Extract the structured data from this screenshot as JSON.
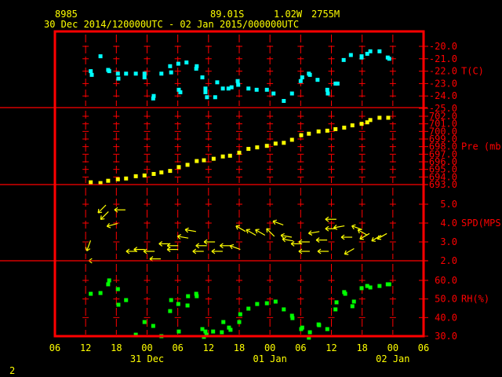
{
  "header": {
    "station": "8985",
    "lat": "89.01S",
    "lon": "1.02W",
    "elev": "2755M",
    "period": "30 Dec 2014/120000UTC - 02 Jan 2015/000000UTC"
  },
  "footer": {
    "page_number": "2"
  },
  "colors": {
    "frame": "#ff0000",
    "text": "#ffff00",
    "temp": "#00ffff",
    "pressure": "#ffff00",
    "wind": "#ffff00",
    "rh": "#00ff00"
  },
  "chart_data": {
    "type": "scatter",
    "x_units": "hours since 30 Dec 2014 00UTC",
    "xlim": [
      6,
      78
    ],
    "x_ticks": [
      {
        "h": 6,
        "label": "06"
      },
      {
        "h": 12,
        "label": "12"
      },
      {
        "h": 18,
        "label": "18"
      },
      {
        "h": 24,
        "label": "00"
      },
      {
        "h": 30,
        "label": "06"
      },
      {
        "h": 36,
        "label": "12"
      },
      {
        "h": 42,
        "label": "18"
      },
      {
        "h": 48,
        "label": "00"
      },
      {
        "h": 54,
        "label": "06"
      },
      {
        "h": 60,
        "label": "12"
      },
      {
        "h": 66,
        "label": "18"
      },
      {
        "h": 72,
        "label": "00"
      },
      {
        "h": 78,
        "label": "06"
      }
    ],
    "date_labels": [
      {
        "h": 24,
        "label": "31 Dec"
      },
      {
        "h": 48,
        "label": "01 Jan"
      },
      {
        "h": 72,
        "label": "02 Jan"
      }
    ],
    "grid": true,
    "panels": [
      {
        "name": "temperature",
        "label": "T(C)",
        "ylim": [
          -25,
          -20
        ],
        "y_ticks": [
          "-20.0",
          "-21.0",
          "-22.0",
          "-23.0",
          "-24.0",
          "-25.0"
        ],
        "tick_values": [
          -20,
          -21,
          -22,
          -23,
          -24,
          -25
        ],
        "label_at": -22,
        "x": [
          13.0,
          13.2,
          14.9,
          16.4,
          16.6,
          18.3,
          18.4,
          19.9,
          21.8,
          23.5,
          23.5,
          25.2,
          25.3,
          26.8,
          28.5,
          28.7,
          30.1,
          30.2,
          30.5,
          31.7,
          33.6,
          33.7,
          34.8,
          35.4,
          35.4,
          35.7,
          37.3,
          37.7,
          38.8,
          39.9,
          40.5,
          41.7,
          41.8,
          43.8,
          45.4,
          47.4,
          48.7,
          50.7,
          52.3,
          54.0,
          54.3,
          55.6,
          55.8,
          57.3,
          59.2,
          59.3,
          60.8,
          61.2,
          62.4,
          63.8,
          65.9,
          65.9,
          67.0,
          67.6,
          69.4,
          71.0,
          71.3
        ],
        "y": [
          -22.0,
          -22.3,
          -20.8,
          -21.9,
          -22.0,
          -22.2,
          -22.6,
          -22.2,
          -22.2,
          -22.2,
          -22.5,
          -24.2,
          -24.0,
          -22.2,
          -21.6,
          -22.1,
          -21.4,
          -23.5,
          -23.7,
          -21.3,
          -21.8,
          -21.6,
          -22.5,
          -23.4,
          -23.7,
          -24.1,
          -24.1,
          -22.9,
          -23.4,
          -23.4,
          -23.3,
          -22.8,
          -23.1,
          -23.4,
          -23.5,
          -23.5,
          -23.8,
          -24.4,
          -23.8,
          -22.8,
          -22.5,
          -22.2,
          -22.3,
          -22.7,
          -23.5,
          -23.8,
          -23.0,
          -23.0,
          -21.1,
          -20.7,
          -20.9,
          -20.8,
          -20.6,
          -20.4,
          -20.4,
          -20.9,
          -21.0
        ]
      },
      {
        "name": "pressure",
        "label": "Pre (mb)",
        "ylim": [
          693,
          702
        ],
        "y_ticks": [
          "702.0",
          "701.0",
          "700.0",
          "699.0",
          "698.0",
          "697.0",
          "696.0",
          "695.0",
          "694.0",
          "693.0"
        ],
        "tick_values": [
          702,
          701,
          700,
          699,
          698,
          697,
          696,
          695,
          694,
          693
        ],
        "label_at": 698,
        "x": [
          13.0,
          14.9,
          16.4,
          18.3,
          19.9,
          21.8,
          23.5,
          25.3,
          26.8,
          28.5,
          30.2,
          31.9,
          33.7,
          35.1,
          37.0,
          38.8,
          40.2,
          42.0,
          43.8,
          45.5,
          47.4,
          49.1,
          50.7,
          52.3,
          54.1,
          55.6,
          57.5,
          59.2,
          60.8,
          62.5,
          64.1,
          65.9,
          67.0,
          67.6,
          69.4,
          71.1
        ],
        "y": [
          693.3,
          693.2,
          693.5,
          693.7,
          693.8,
          694.1,
          694.2,
          694.4,
          694.6,
          694.8,
          695.3,
          695.6,
          696.1,
          696.2,
          696.4,
          696.7,
          696.8,
          697.2,
          697.7,
          697.9,
          698.1,
          698.4,
          698.5,
          698.9,
          699.5,
          699.7,
          700.0,
          700.1,
          700.3,
          700.5,
          700.8,
          701.0,
          701.2,
          701.5,
          701.8,
          701.8
        ]
      },
      {
        "name": "wind",
        "label": "SPD(MPS)",
        "ylim": [
          2,
          5
        ],
        "y_ticks": [
          "5.0",
          "4.0",
          "3.0",
          "2.0"
        ],
        "tick_values": [
          5,
          4,
          3,
          2
        ],
        "label_at": 4,
        "x": [
          15.2,
          15.7,
          18.7,
          17.2,
          12.6,
          13.7,
          21.0,
          22.5,
          24.4,
          25.6,
          27.4,
          29.0,
          29.0,
          31.0,
          32.5,
          34.6,
          34.0,
          36.2,
          37.7,
          39.3,
          41.2,
          42.3,
          44.3,
          46.1,
          48.1,
          49.6,
          51.2,
          51.5,
          53.2,
          54.7,
          54.7,
          56.6,
          58.1,
          58.4,
          59.9,
          59.9,
          61.5,
          63.0,
          63.5,
          65.0,
          66.1,
          66.5,
          68.8,
          69.9
        ],
        "y": [
          4.75,
          4.4,
          4.7,
          3.9,
          2.8,
          2.0,
          2.5,
          2.6,
          2.5,
          2.1,
          2.9,
          2.8,
          2.6,
          3.25,
          3.6,
          2.8,
          2.5,
          3.0,
          2.5,
          2.8,
          2.7,
          3.7,
          3.5,
          3.5,
          3.5,
          4.0,
          3.3,
          3.1,
          2.9,
          3.0,
          2.5,
          3.5,
          3.1,
          2.5,
          4.2,
          3.7,
          3.8,
          3.25,
          2.5,
          3.75,
          3.5,
          3.3,
          3.2,
          3.3
        ],
        "direction_from_deg": [
          45,
          45,
          90,
          75,
          20,
          90,
          90,
          90,
          90,
          90,
          90,
          90,
          90,
          100,
          100,
          90,
          90,
          90,
          90,
          90,
          110,
          120,
          120,
          120,
          135,
          110,
          100,
          100,
          90,
          90,
          90,
          80,
          90,
          90,
          90,
          90,
          80,
          90,
          60,
          110,
          120,
          60,
          60,
          60
        ]
      },
      {
        "name": "relative_humidity",
        "label": "RH(%)",
        "ylim": [
          30,
          60
        ],
        "y_ticks": [
          "60.0",
          "50.0",
          "40.0",
          "30.0"
        ],
        "tick_values": [
          60,
          50,
          40,
          30
        ],
        "label_at": 50,
        "x": [
          13.0,
          14.9,
          16.4,
          16.6,
          18.3,
          18.4,
          19.9,
          21.8,
          23.5,
          25.2,
          26.8,
          28.5,
          28.7,
          30.1,
          30.2,
          31.9,
          32.0,
          33.6,
          33.7,
          34.8,
          35.4,
          35.1,
          35.6,
          36.9,
          38.6,
          38.9,
          40.0,
          40.3,
          42.0,
          42.2,
          43.8,
          45.5,
          47.4,
          49.1,
          50.7,
          52.3,
          52.4,
          54.1,
          54.3,
          55.8,
          55.6,
          57.5,
          57.6,
          59.2,
          60.8,
          61.0,
          62.5,
          62.7,
          64.1,
          64.4,
          65.9,
          67.0,
          67.6,
          69.4,
          71.0,
          71.3
        ],
        "y": [
          52.8,
          53.2,
          57.9,
          60.0,
          55.3,
          46.9,
          49.4,
          30.8,
          37.6,
          35.5,
          30.0,
          43.5,
          49.4,
          47.3,
          32.5,
          46.5,
          51.5,
          52.8,
          51.5,
          33.8,
          32.5,
          29.6,
          30.8,
          32.5,
          32.1,
          37.6,
          34.6,
          33.4,
          37.6,
          41.8,
          44.8,
          47.3,
          47.7,
          48.6,
          44.4,
          41.0,
          39.7,
          33.8,
          34.6,
          32.1,
          29.2,
          36.3,
          35.9,
          33.8,
          44.4,
          48.2,
          53.7,
          52.8,
          46.1,
          48.6,
          55.8,
          57.0,
          56.2,
          57.0,
          57.9,
          57.9
        ]
      }
    ]
  }
}
